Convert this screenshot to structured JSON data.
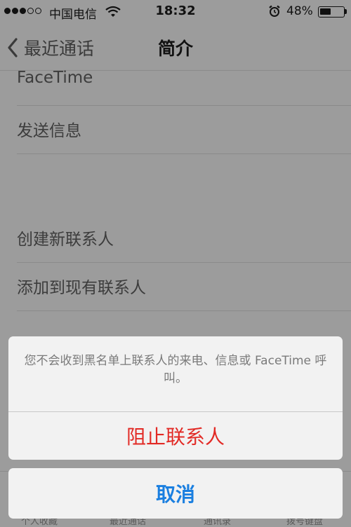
{
  "status_bar": {
    "signal_dots_filled": 3,
    "signal_dots_total": 5,
    "carrier": "中国电信",
    "time": "18:32",
    "battery_percent": "48%",
    "battery_level": 0.48,
    "icons": [
      "wifi-icon",
      "alarm-icon",
      "battery-icon"
    ]
  },
  "nav": {
    "back_label": "最近通话",
    "title": "简介"
  },
  "rows": [
    "FaceTime",
    "发送信息",
    "创建新联系人",
    "添加到现有联系人"
  ],
  "tab_bar": {
    "labels": [
      "个人收藏",
      "最近通话",
      "通讯录",
      "拨号键盘"
    ]
  },
  "action_sheet": {
    "message": "您不会收到黑名单上联系人的来电、信息或 FaceTime 呼叫。",
    "block_label": "阻止联系人",
    "cancel_label": "取消"
  },
  "colors": {
    "dim_background": "#9c9c9c",
    "sheet_background": "#f2f2f2",
    "destructive": "#e22a25",
    "cancel_blue": "#1a7fe0"
  }
}
